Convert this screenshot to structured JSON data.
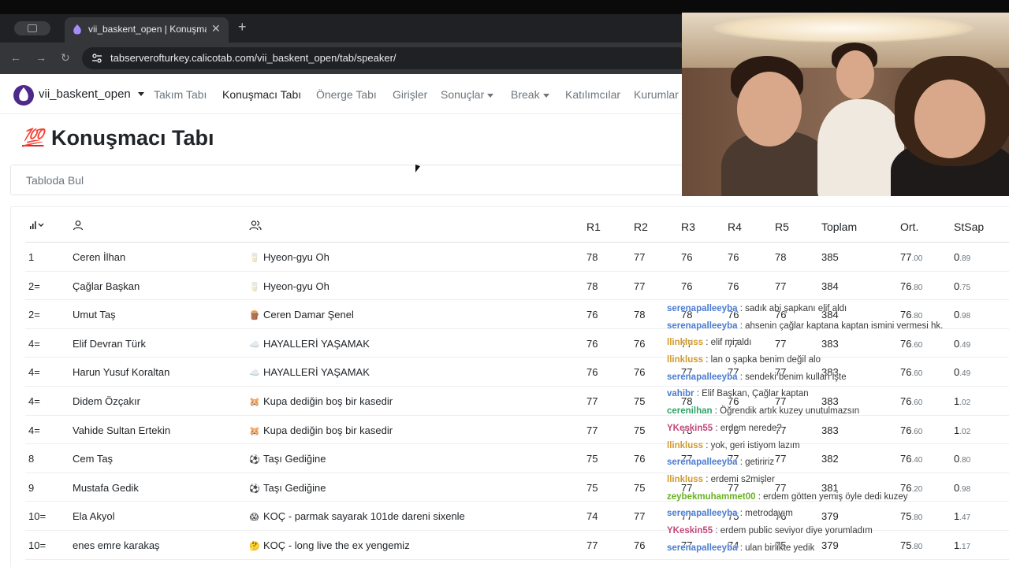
{
  "browser": {
    "tab_title": "vii_baskent_open | Konuşmacı Tabı",
    "url": "tabserverofturkey.calicotab.com/vii_baskent_open/tab/speaker/",
    "new_tab": "+",
    "close": "✕"
  },
  "navbar": {
    "brand": "vii_baskent_open",
    "links": [
      {
        "label": "Takım Tabı",
        "active": false
      },
      {
        "label": "Konuşmacı Tabı",
        "active": true
      },
      {
        "label": "Önerge Tabı",
        "active": false
      },
      {
        "label": "Girişler",
        "active": false
      },
      {
        "label": "Sonuçlar",
        "active": false,
        "dropdown": true
      },
      {
        "label": "Break",
        "active": false,
        "dropdown": true
      },
      {
        "label": "Katılımcılar",
        "active": false
      },
      {
        "label": "Kurumlar",
        "active": false
      }
    ]
  },
  "page": {
    "title": "Konuşmacı Tabı",
    "title_emoji": "💯",
    "search_placeholder": "Tabloda Bul"
  },
  "table": {
    "headers": [
      "R1",
      "R2",
      "R3",
      "R4",
      "R5",
      "Toplam",
      "Ort.",
      "StSap"
    ],
    "rows": [
      {
        "rank": "1",
        "speaker": "Ceren İlhan",
        "team_icon": "🥛",
        "team": "Hyeon-gyu Oh",
        "r": [
          "78",
          "77",
          "76",
          "76",
          "78"
        ],
        "total": "385",
        "avg_int": "77",
        "avg_dec": ".00",
        "sd_int": "0",
        "sd_dec": ".89"
      },
      {
        "rank": "2=",
        "speaker": "Çağlar Başkan",
        "team_icon": "🥛",
        "team": "Hyeon-gyu Oh",
        "r": [
          "78",
          "77",
          "76",
          "76",
          "77"
        ],
        "total": "384",
        "avg_int": "76",
        "avg_dec": ".80",
        "sd_int": "0",
        "sd_dec": ".75"
      },
      {
        "rank": "2=",
        "speaker": "Umut Taş",
        "team_icon": "🪵",
        "team": "Ceren Damar Şenel",
        "r": [
          "76",
          "78",
          "78",
          "76",
          "76"
        ],
        "total": "384",
        "avg_int": "76",
        "avg_dec": ".80",
        "sd_int": "0",
        "sd_dec": ".98"
      },
      {
        "rank": "4=",
        "speaker": "Elif Devran Türk",
        "team_icon": "☁️",
        "team": "HAYALLERİ YAŞAMAK",
        "r": [
          "76",
          "76",
          "77",
          "77",
          "77"
        ],
        "total": "383",
        "avg_int": "76",
        "avg_dec": ".60",
        "sd_int": "0",
        "sd_dec": ".49"
      },
      {
        "rank": "4=",
        "speaker": "Harun Yusuf Koraltan",
        "team_icon": "☁️",
        "team": "HAYALLERİ YAŞAMAK",
        "r": [
          "76",
          "76",
          "77",
          "77",
          "77"
        ],
        "total": "383",
        "avg_int": "76",
        "avg_dec": ".60",
        "sd_int": "0",
        "sd_dec": ".49"
      },
      {
        "rank": "4=",
        "speaker": "Didem Özçakır",
        "team_icon": "🐹",
        "team": "Kupa dediğin boş bir kasedir",
        "r": [
          "77",
          "75",
          "78",
          "76",
          "77"
        ],
        "total": "383",
        "avg_int": "76",
        "avg_dec": ".60",
        "sd_int": "1",
        "sd_dec": ".02"
      },
      {
        "rank": "4=",
        "speaker": "Vahide Sultan Ertekin",
        "team_icon": "🐹",
        "team": "Kupa dediğin boş bir kasedir",
        "r": [
          "77",
          "75",
          "78",
          "76",
          "77"
        ],
        "total": "383",
        "avg_int": "76",
        "avg_dec": ".60",
        "sd_int": "1",
        "sd_dec": ".02"
      },
      {
        "rank": "8",
        "speaker": "Cem Taş",
        "team_icon": "⚽",
        "team": "Taşı Gediğine",
        "r": [
          "75",
          "76",
          "77",
          "77",
          "77"
        ],
        "total": "382",
        "avg_int": "76",
        "avg_dec": ".40",
        "sd_int": "0",
        "sd_dec": ".80"
      },
      {
        "rank": "9",
        "speaker": "Mustafa Gedik",
        "team_icon": "⚽",
        "team": "Taşı Gediğine",
        "r": [
          "75",
          "75",
          "77",
          "77",
          "77"
        ],
        "total": "381",
        "avg_int": "76",
        "avg_dec": ".20",
        "sd_int": "0",
        "sd_dec": ".98"
      },
      {
        "rank": "10=",
        "speaker": "Ela Akyol",
        "team_icon": "😱",
        "team": "KOÇ - parmak sayarak 101de dareni sixenle",
        "r": [
          "74",
          "77",
          "77",
          "75",
          "76"
        ],
        "total": "379",
        "avg_int": "75",
        "avg_dec": ".80",
        "sd_int": "1",
        "sd_dec": ".47"
      },
      {
        "rank": "10=",
        "speaker": "enes emre karakaş",
        "team_icon": "🤔",
        "team": "KOÇ - long live the ex yengemiz",
        "r": [
          "77",
          "76",
          "77",
          "74",
          "75"
        ],
        "total": "379",
        "avg_int": "75",
        "avg_dec": ".80",
        "sd_int": "1",
        "sd_dec": ".17"
      }
    ]
  },
  "chat": [
    {
      "user": "serenapalleeyba",
      "color": "#4a7bd1",
      "msg": "sadık abi şapkanı elif aldı"
    },
    {
      "user": "serenapalleeyba",
      "color": "#4a7bd1",
      "msg": "ahsenin çağlar kaptana kaptan ismini vermesi hk."
    },
    {
      "user": "llinkluss",
      "color": "#d19a2a",
      "msg": "elif mi aldı"
    },
    {
      "user": "llinkluss",
      "color": "#d19a2a",
      "msg": "lan o şapka benim değil alo"
    },
    {
      "user": "serenapalleeyba",
      "color": "#4a7bd1",
      "msg": "sendeki benim kullan işte"
    },
    {
      "user": "vahibr",
      "color": "#4a7bd1",
      "msg": "Elif Başkan, Çağlar kaptan"
    },
    {
      "user": "cerenilhan",
      "color": "#2fa36b",
      "msg": "Öğrendik artık kuzey unutulmazsın"
    },
    {
      "user": "YKeskin55",
      "color": "#c2497a",
      "msg": "erdem nerede?"
    },
    {
      "user": "llinkluss",
      "color": "#d19a2a",
      "msg": "yok, geri istiyom lazım"
    },
    {
      "user": "serenapalleeyba",
      "color": "#4a7bd1",
      "msg": "getiririz"
    },
    {
      "user": "llinkluss",
      "color": "#d19a2a",
      "msg": "erdemi s2mişler"
    },
    {
      "user": "zeybekmuhammet00",
      "color": "#6ab023",
      "msg": "erdem götten yemiş öyle dedi kuzey"
    },
    {
      "user": "serenapalleeyba",
      "color": "#4a7bd1",
      "msg": "metrodayım"
    },
    {
      "user": "YKeskin55",
      "color": "#c2497a",
      "msg": "erdem public seviyor diye yorumladım"
    },
    {
      "user": "serenapalleeyba",
      "color": "#4a7bd1",
      "msg": "ulan birlikte yedik"
    }
  ]
}
